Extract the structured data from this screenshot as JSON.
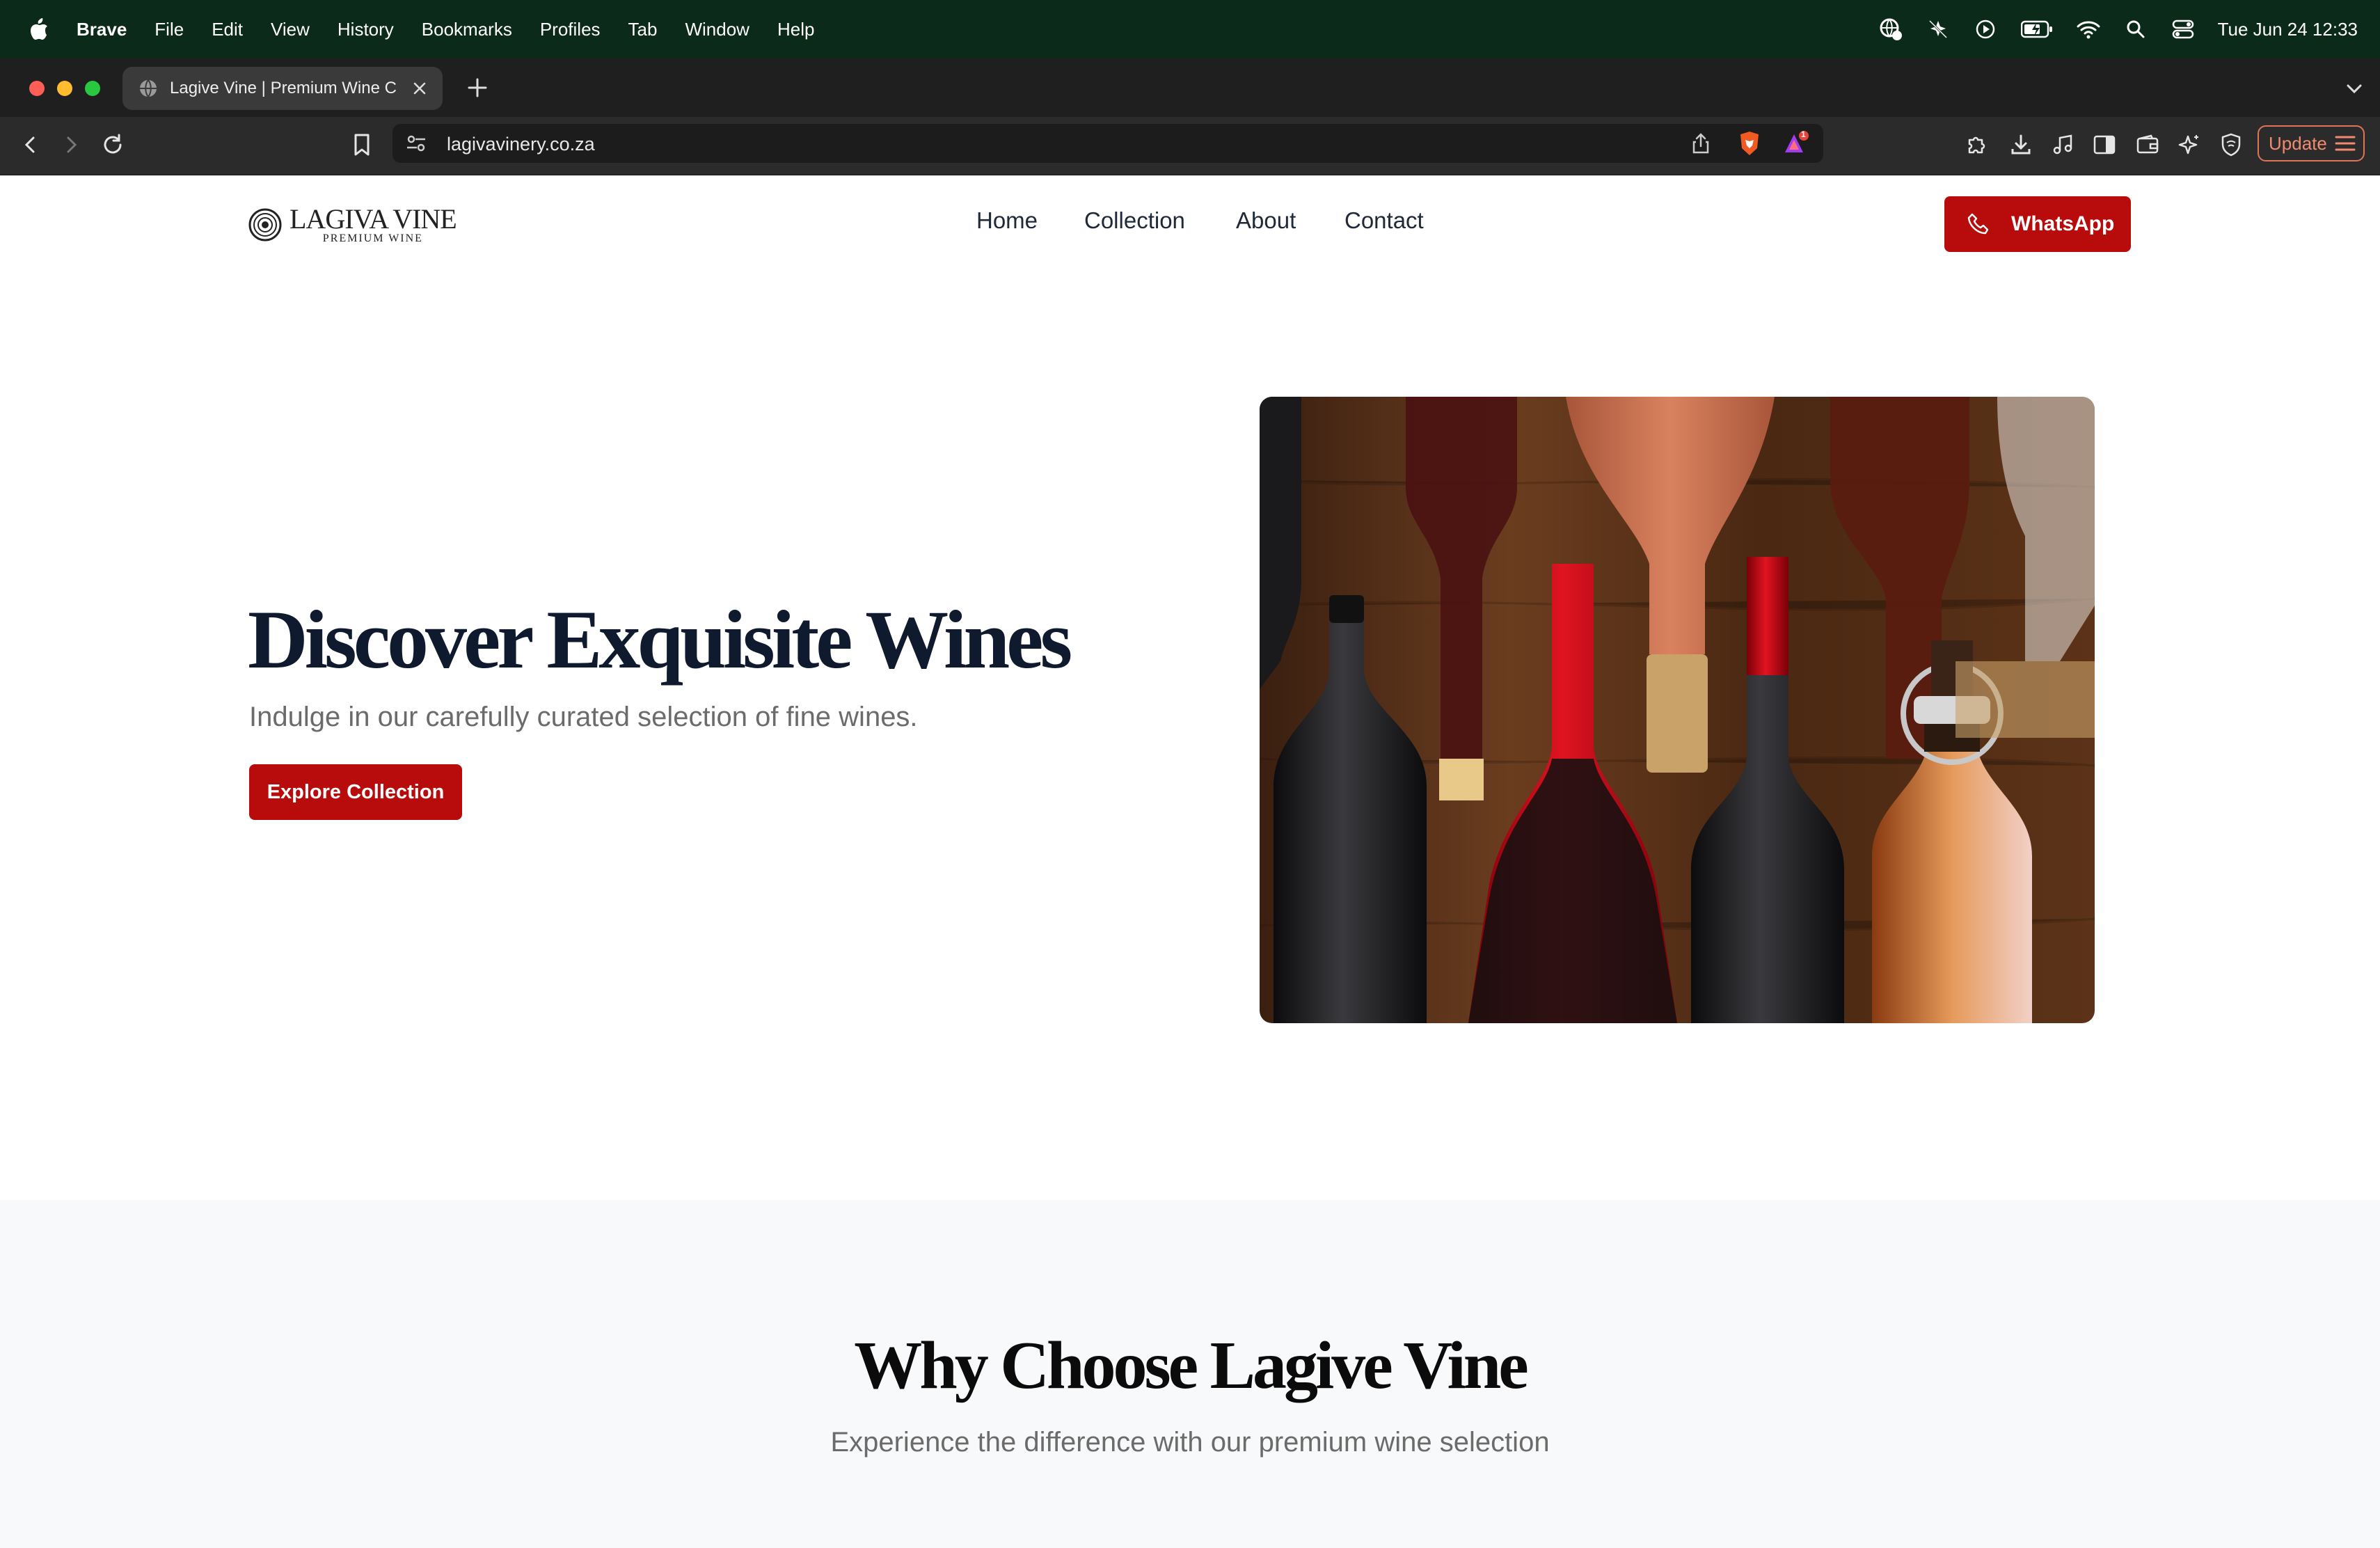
{
  "menubar": {
    "app_name": "Brave",
    "items": [
      "File",
      "Edit",
      "View",
      "History",
      "Bookmarks",
      "Profiles",
      "Tab",
      "Window",
      "Help"
    ],
    "clock": "Tue Jun 24  12:33"
  },
  "browser": {
    "tab_title": "Lagive Vine | Premium Wine C",
    "url": "lagivavinery.co.za",
    "update_label": "Update",
    "shields_badge": "1"
  },
  "site": {
    "logo": {
      "brand": "LAGIVA VINE",
      "tagline": "PREMIUM WINE"
    },
    "nav": [
      "Home",
      "Collection",
      "About",
      "Contact"
    ],
    "whatsapp_label": "WhatsApp",
    "hero": {
      "title": "Discover Exquisite Wines",
      "subtitle": "Indulge in our carefully curated selection of fine wines.",
      "cta": "Explore Collection"
    },
    "why": {
      "title": "Why Choose Lagive Vine",
      "subtitle": "Experience the difference with our premium wine selection"
    }
  },
  "colors": {
    "menubar_bg": "#0b2a1a",
    "accent_red": "#b80b0b",
    "heading_navy": "#0f1a2e",
    "section_bg": "#f8f9fa"
  }
}
